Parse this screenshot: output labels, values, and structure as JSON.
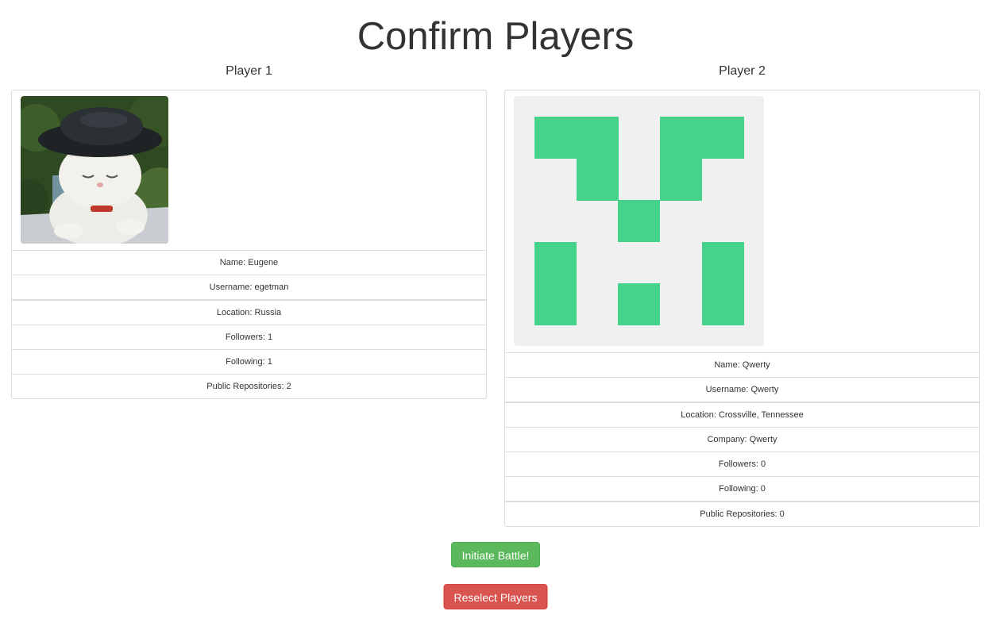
{
  "title": "Confirm Players",
  "player1": {
    "heading": "Player 1",
    "avatar_icon": "cat-avatar",
    "info": {
      "name": "Name: Eugene",
      "username": "Username: egetman",
      "location": "Location: Russia",
      "followers": "Followers: 1",
      "following": "Following: 1",
      "repos": "Public Repositories: 2"
    }
  },
  "player2": {
    "heading": "Player 2",
    "avatar_icon": "identicon-avatar",
    "identicon_color": "#45d38b",
    "info": {
      "name": "Name: Qwerty",
      "username": "Username: Qwerty",
      "location": "Location: Crossville, Tennessee",
      "company": "Company: Qwerty",
      "followers": "Followers: 0",
      "following": "Following: 0",
      "repos": "Public Repositories: 0"
    }
  },
  "buttons": {
    "initiate": "Initiate Battle!",
    "reselect": "Reselect Players"
  },
  "colors": {
    "success": "#5cb85c",
    "danger": "#d9534f",
    "border": "#dddddd"
  }
}
